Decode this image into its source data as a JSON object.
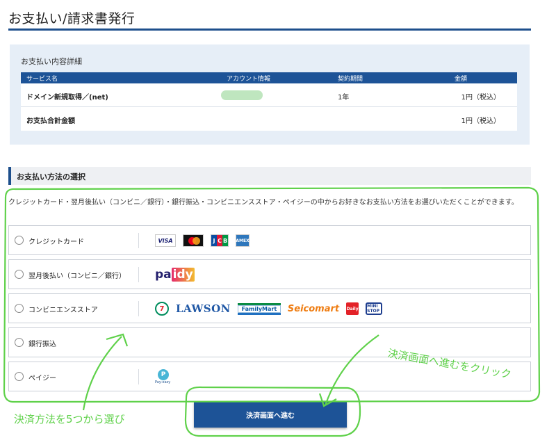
{
  "page": {
    "title": "お支払い/請求書発行"
  },
  "details": {
    "heading": "お支払い内容詳細",
    "columns": [
      "サービス名",
      "アカウント情報",
      "契約期間",
      "金額"
    ],
    "rows": [
      {
        "service": "ドメイン新規取得／(net)",
        "period": "1年",
        "amount": "1円（税込）"
      }
    ],
    "total_label": "お支払合計金額",
    "total_amount": "1円（税込）"
  },
  "payment": {
    "heading": "お支払い方法の選択",
    "description": "クレジットカード・翌月後払い（コンビニ／銀行）・銀行振込・コンビニエンスストア・ペイジーの中からお好きなお支払い方法をお選びいただくことができます。",
    "options": [
      {
        "label": "クレジットカード",
        "logos": [
          "VISA",
          "mastercard",
          "JCB",
          "AMERICAN EXPRESS"
        ]
      },
      {
        "label": "翌月後払い（コンビニ／銀行）",
        "logos": [
          "paidy"
        ]
      },
      {
        "label": "コンビニエンスストア",
        "logos": [
          "7",
          "LAWSON",
          "FamilyMart",
          "Seicomart",
          "Daily",
          "MINI STOP"
        ]
      },
      {
        "label": "銀行振込",
        "logos": []
      },
      {
        "label": "ペイジー",
        "logos": [
          "Pay-easy"
        ]
      }
    ],
    "logo_text": {
      "visa": "VISA",
      "jcb": [
        "J",
        "C",
        "B"
      ],
      "amex": "AMEX",
      "paidy_a": "pa",
      "paidy_b": "idy",
      "seven": "7",
      "lawson": "LAWSON",
      "familymart": "FamilyMart",
      "seicomart": "Seicomart",
      "daily": "Daily",
      "ministop": "MINI STOP",
      "payeasy_p": "P",
      "payeasy_text": "Pay-easy"
    }
  },
  "proceed_button": {
    "label": "決済画面へ進む"
  },
  "annotations": {
    "left_note": "決済方法を5つから選び",
    "right_note": "決済画面へ進むをクリック",
    "color": "#5fd14a"
  },
  "colors": {
    "brand": "#1d5397",
    "heading_rule": "#1d4f8c",
    "panel": "#e6eef7"
  }
}
